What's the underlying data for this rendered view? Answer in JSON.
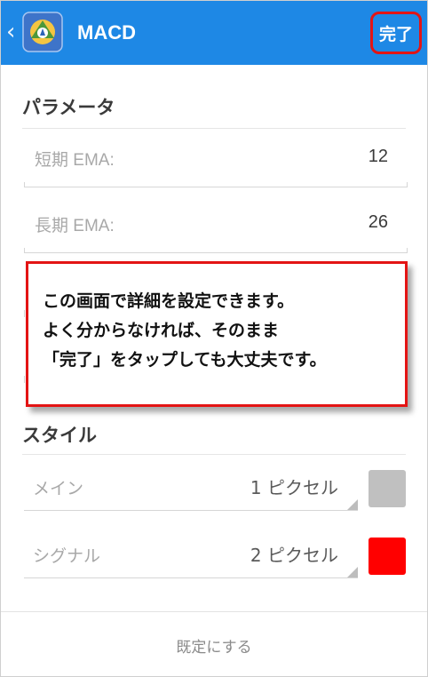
{
  "header": {
    "back_icon": "chevron-left-icon",
    "app_icon": "metatrader-logo-icon",
    "title": "MACD",
    "done_label": "完了",
    "accent_color": "#1e88e5",
    "highlight_color": "#e31414"
  },
  "parameters": {
    "heading": "パラメータ",
    "fields": [
      {
        "label": "短期 EMA:",
        "value": "12"
      },
      {
        "label": "長期 EMA:",
        "value": "26"
      }
    ]
  },
  "style": {
    "heading": "スタイル",
    "rows": [
      {
        "label": "メイン",
        "value": "1 ピクセル",
        "color": "#c0c0c0"
      },
      {
        "label": "シグナル",
        "value": "2 ピクセル",
        "color": "#ff0000"
      }
    ]
  },
  "footer": {
    "reset_label": "既定にする"
  },
  "callout": {
    "lines": [
      "この画面で詳細を設定できます。",
      "よく分からなければ、そのまま",
      "「完了」をタップしても大丈夫です。"
    ]
  }
}
